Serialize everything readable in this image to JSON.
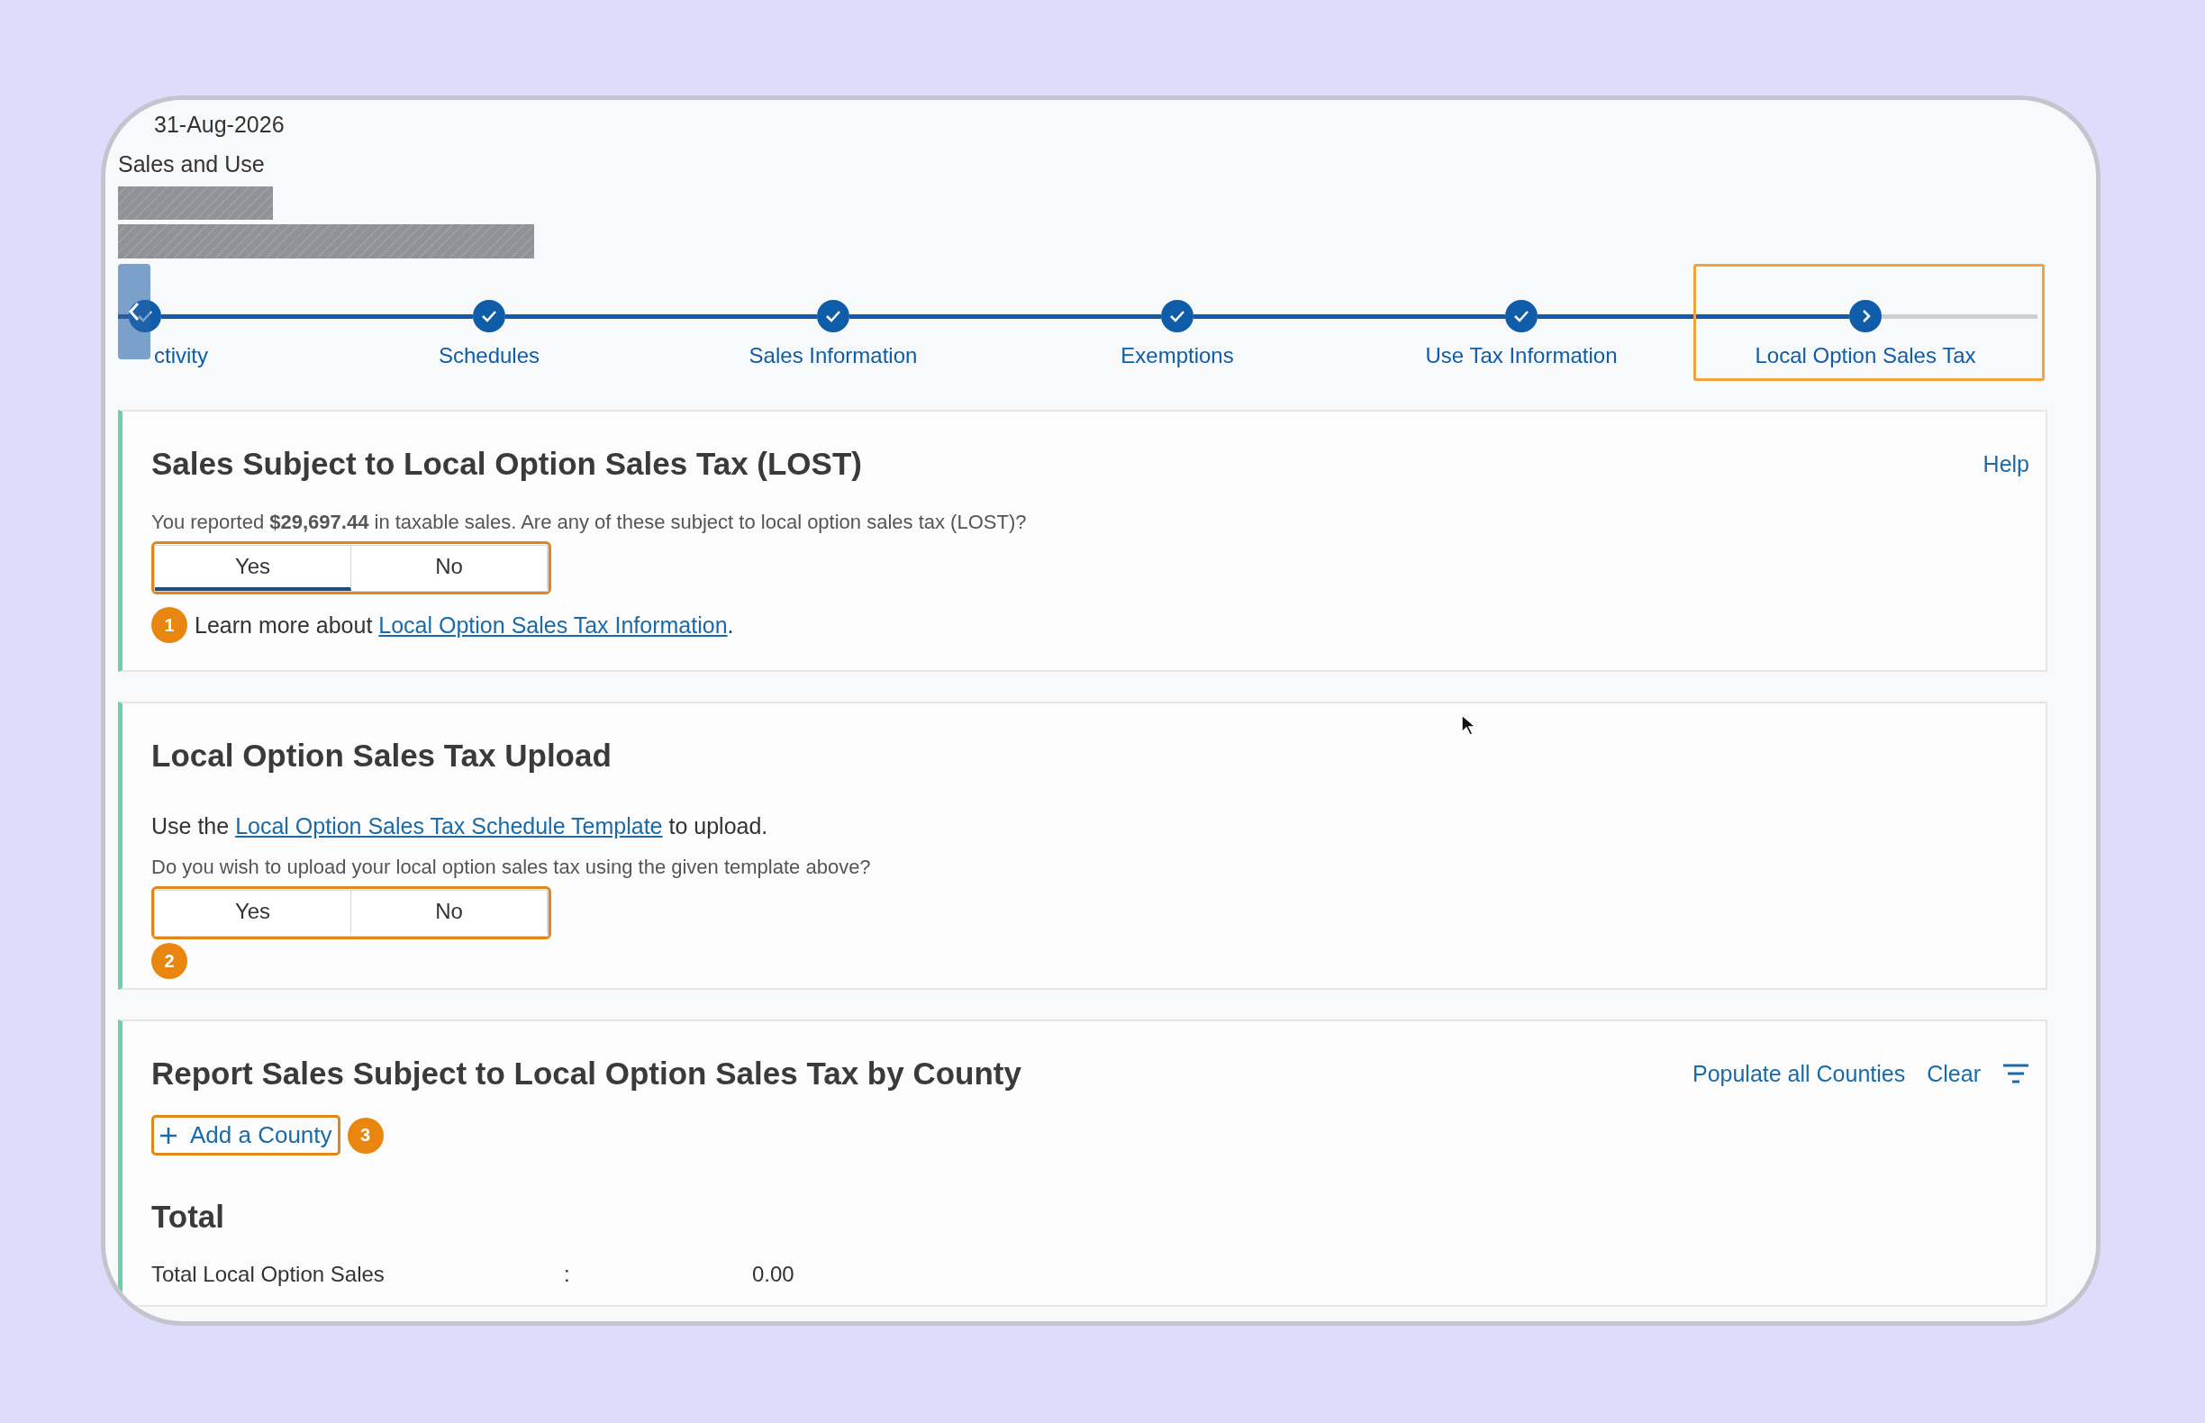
{
  "header": {
    "date": "31-Aug-2026",
    "subtitle": "Sales and Use"
  },
  "stepper": {
    "steps": [
      {
        "label": "ctivity",
        "completed": true,
        "highlighted": false
      },
      {
        "label": "Schedules",
        "completed": true,
        "highlighted": false
      },
      {
        "label": "Sales Information",
        "completed": true,
        "highlighted": false
      },
      {
        "label": "Exemptions",
        "completed": true,
        "highlighted": false
      },
      {
        "label": "Use Tax Information",
        "completed": true,
        "highlighted": false
      },
      {
        "label": "Local Option Sales Tax",
        "completed": false,
        "highlighted": true
      }
    ]
  },
  "lost_section": {
    "title": "Sales Subject to Local Option Sales Tax (LOST)",
    "help_link": "Help",
    "prompt": "You reported **$29,697.44** in taxable sales. Are any of these subject to local option sales tax (LOST)?",
    "options": [
      {
        "label": "Yes",
        "selected": true
      },
      {
        "label": "No",
        "selected": false
      }
    ],
    "highlighted": true,
    "callout": "1",
    "note": "Learn more about",
    "note_link": "Local Option Sales Tax Information",
    "note_end": "."
  },
  "upload_section": {
    "title": "Local Option Sales Tax Upload",
    "intro": "Use the",
    "intro_link": "Local Option Sales Tax Schedule Template",
    "intro_end": "to upload.",
    "prompt": "Do you wish to upload your local option sales tax using the given template above?",
    "options": [
      {
        "label": "Yes",
        "selected": false
      },
      {
        "label": "No",
        "selected": false
      }
    ],
    "highlighted": true,
    "callout": "2"
  },
  "county_section": {
    "title": "Report Sales Subject to Local Option Sales Tax by County",
    "actions": [
      "Populate all Counties",
      "Clear"
    ],
    "add_button": {
      "label": "Add a County",
      "highlighted": true,
      "callout": "3"
    },
    "total_title": "Total",
    "total_rows": [
      {
        "label": "Total Local Option Sales",
        "separator": ":",
        "value": "0.00"
      }
    ]
  }
}
